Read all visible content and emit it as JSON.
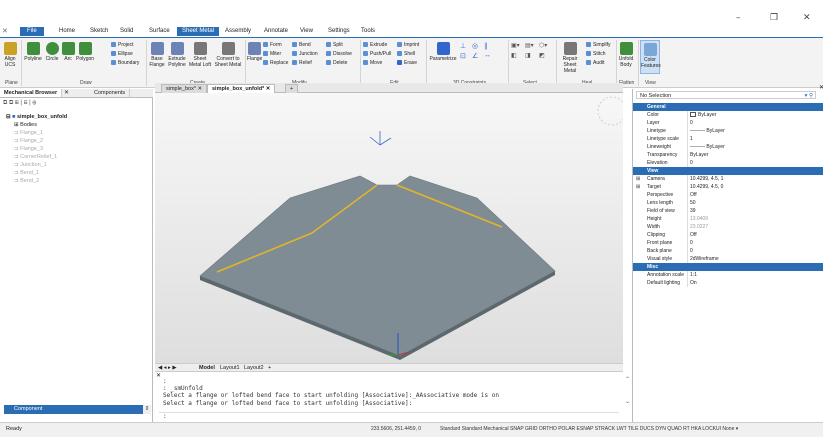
{
  "app": {
    "tabs": [
      "File",
      "Home",
      "Sketch",
      "Solid",
      "Surface",
      "Sheet Metal",
      "Assembly",
      "Annotate",
      "View",
      "Settings",
      "Tools"
    ],
    "active_tab": "Sheet Metal",
    "window_controls": {
      "minimize": "–",
      "maximize": "❐",
      "close": "✕"
    }
  },
  "ribbon": {
    "groups": [
      {
        "label": "Plane"
      },
      {
        "label": "Draw"
      },
      {
        "label": "Create"
      },
      {
        "label": "Modify"
      },
      {
        "label": "Edit"
      },
      {
        "label": "3D Constraints"
      },
      {
        "label": "Select"
      },
      {
        "label": "Heal"
      },
      {
        "label": "Flatten"
      },
      {
        "label": "View"
      }
    ],
    "buttons": {
      "align_ucs": "Align UCS",
      "polyline": "Polyline",
      "circle": "Circle",
      "arc": "Arc",
      "polygon": "Polygon",
      "project": "Project",
      "ellipse": "Ellipse",
      "boundary": "Boundary",
      "base_flange": "Base Flange",
      "extrude_polyline": "Extrude Polyline",
      "sheet_metal_loft": "Sheet Metal Loft",
      "convert_sheet_metal": "Convert to Sheet Metal",
      "flange": "Flange",
      "miter": "Miter",
      "replace": "Replace",
      "form": "Form",
      "junction": "Junction",
      "relief": "Relief",
      "bend": "Bend",
      "dissolve": "Dissolve",
      "delete": "Delete",
      "split": "Split",
      "extrude": "Extrude",
      "push_pull": "Push/Pull",
      "move": "Move",
      "imprint": "Imprint",
      "shell": "Shell",
      "erase": "Erase",
      "parametrize": "Parametrize",
      "repair_sheet_metal": "Repair Sheet Metal",
      "simplify": "Simplify",
      "stitch": "Stitch",
      "audit": "Audit",
      "unfold_body": "Unfold Body",
      "color_features": "Color Features"
    }
  },
  "left_panel": {
    "tabs": [
      "Mechanical Browser",
      "Components"
    ],
    "tree": {
      "root": "simple_box_unfold",
      "items": [
        "Bodies",
        "Flange_1",
        "Flange_2",
        "Flange_3",
        "CornerRelief_1",
        "Junction_1",
        "Bend_1",
        "Bend_2"
      ]
    },
    "bottom_select": "Component"
  },
  "doc_tabs": [
    "simple_box*",
    "simple_box_unfold*"
  ],
  "active_doc_tab": "simple_box_unfold*",
  "layout_tabs": [
    "Model",
    "Layout1",
    "Layout2"
  ],
  "command_line": {
    "lines": [
      ":",
      ": _smUnfold",
      "Select a flange or lofted bend face to start unfolding [Associative]:_AAssociative mode is on",
      "Select a flange or lofted bend face to start unfolding [Associative]:"
    ],
    "prompt": ":"
  },
  "properties": {
    "selection": "No Selection",
    "sections": [
      {
        "title": "General",
        "rows": [
          [
            "Color",
            "ByLayer"
          ],
          [
            "Layer",
            "0"
          ],
          [
            "Linetype",
            "——— ByLayer"
          ],
          [
            "Linetype scale",
            "1"
          ],
          [
            "Lineweight",
            "——— ByLayer"
          ],
          [
            "Transparency",
            "ByLayer"
          ],
          [
            "Elevation",
            "0"
          ]
        ]
      },
      {
        "title": "View",
        "rows": [
          [
            "Camera",
            "10.4299, 4.5, 1"
          ],
          [
            "Target",
            "10.4299, 4.5, 0"
          ],
          [
            "Perspective",
            "Off"
          ],
          [
            "Lens length",
            "50"
          ],
          [
            "Field of view",
            "39"
          ],
          [
            "Height",
            "13.0409"
          ],
          [
            "Width",
            "23.0227"
          ],
          [
            "Clipping",
            "Off"
          ],
          [
            "Front plane",
            "0"
          ],
          [
            "Back plane",
            "0"
          ],
          [
            "Visual style",
            "2dWireframe"
          ]
        ]
      },
      {
        "title": "Misc",
        "rows": [
          [
            "Annotation scale",
            "1:1"
          ],
          [
            "Default lighting",
            "On"
          ]
        ]
      }
    ]
  },
  "status": {
    "left": "Ready",
    "coords": "233.5606, 251.4459, 0",
    "right": "Standard  Standard  Mechanical  SNAP  GRID  ORTHO  POLAR  ESNAP  STRACK  LWT  TILE  DUCS  DYN  QUAD  RT  HKA  LOCKUI  None ▾"
  },
  "colors": {
    "accent": "#2a6db5",
    "sheet": "#7f8c94",
    "bend_line": "#e0b52b"
  }
}
